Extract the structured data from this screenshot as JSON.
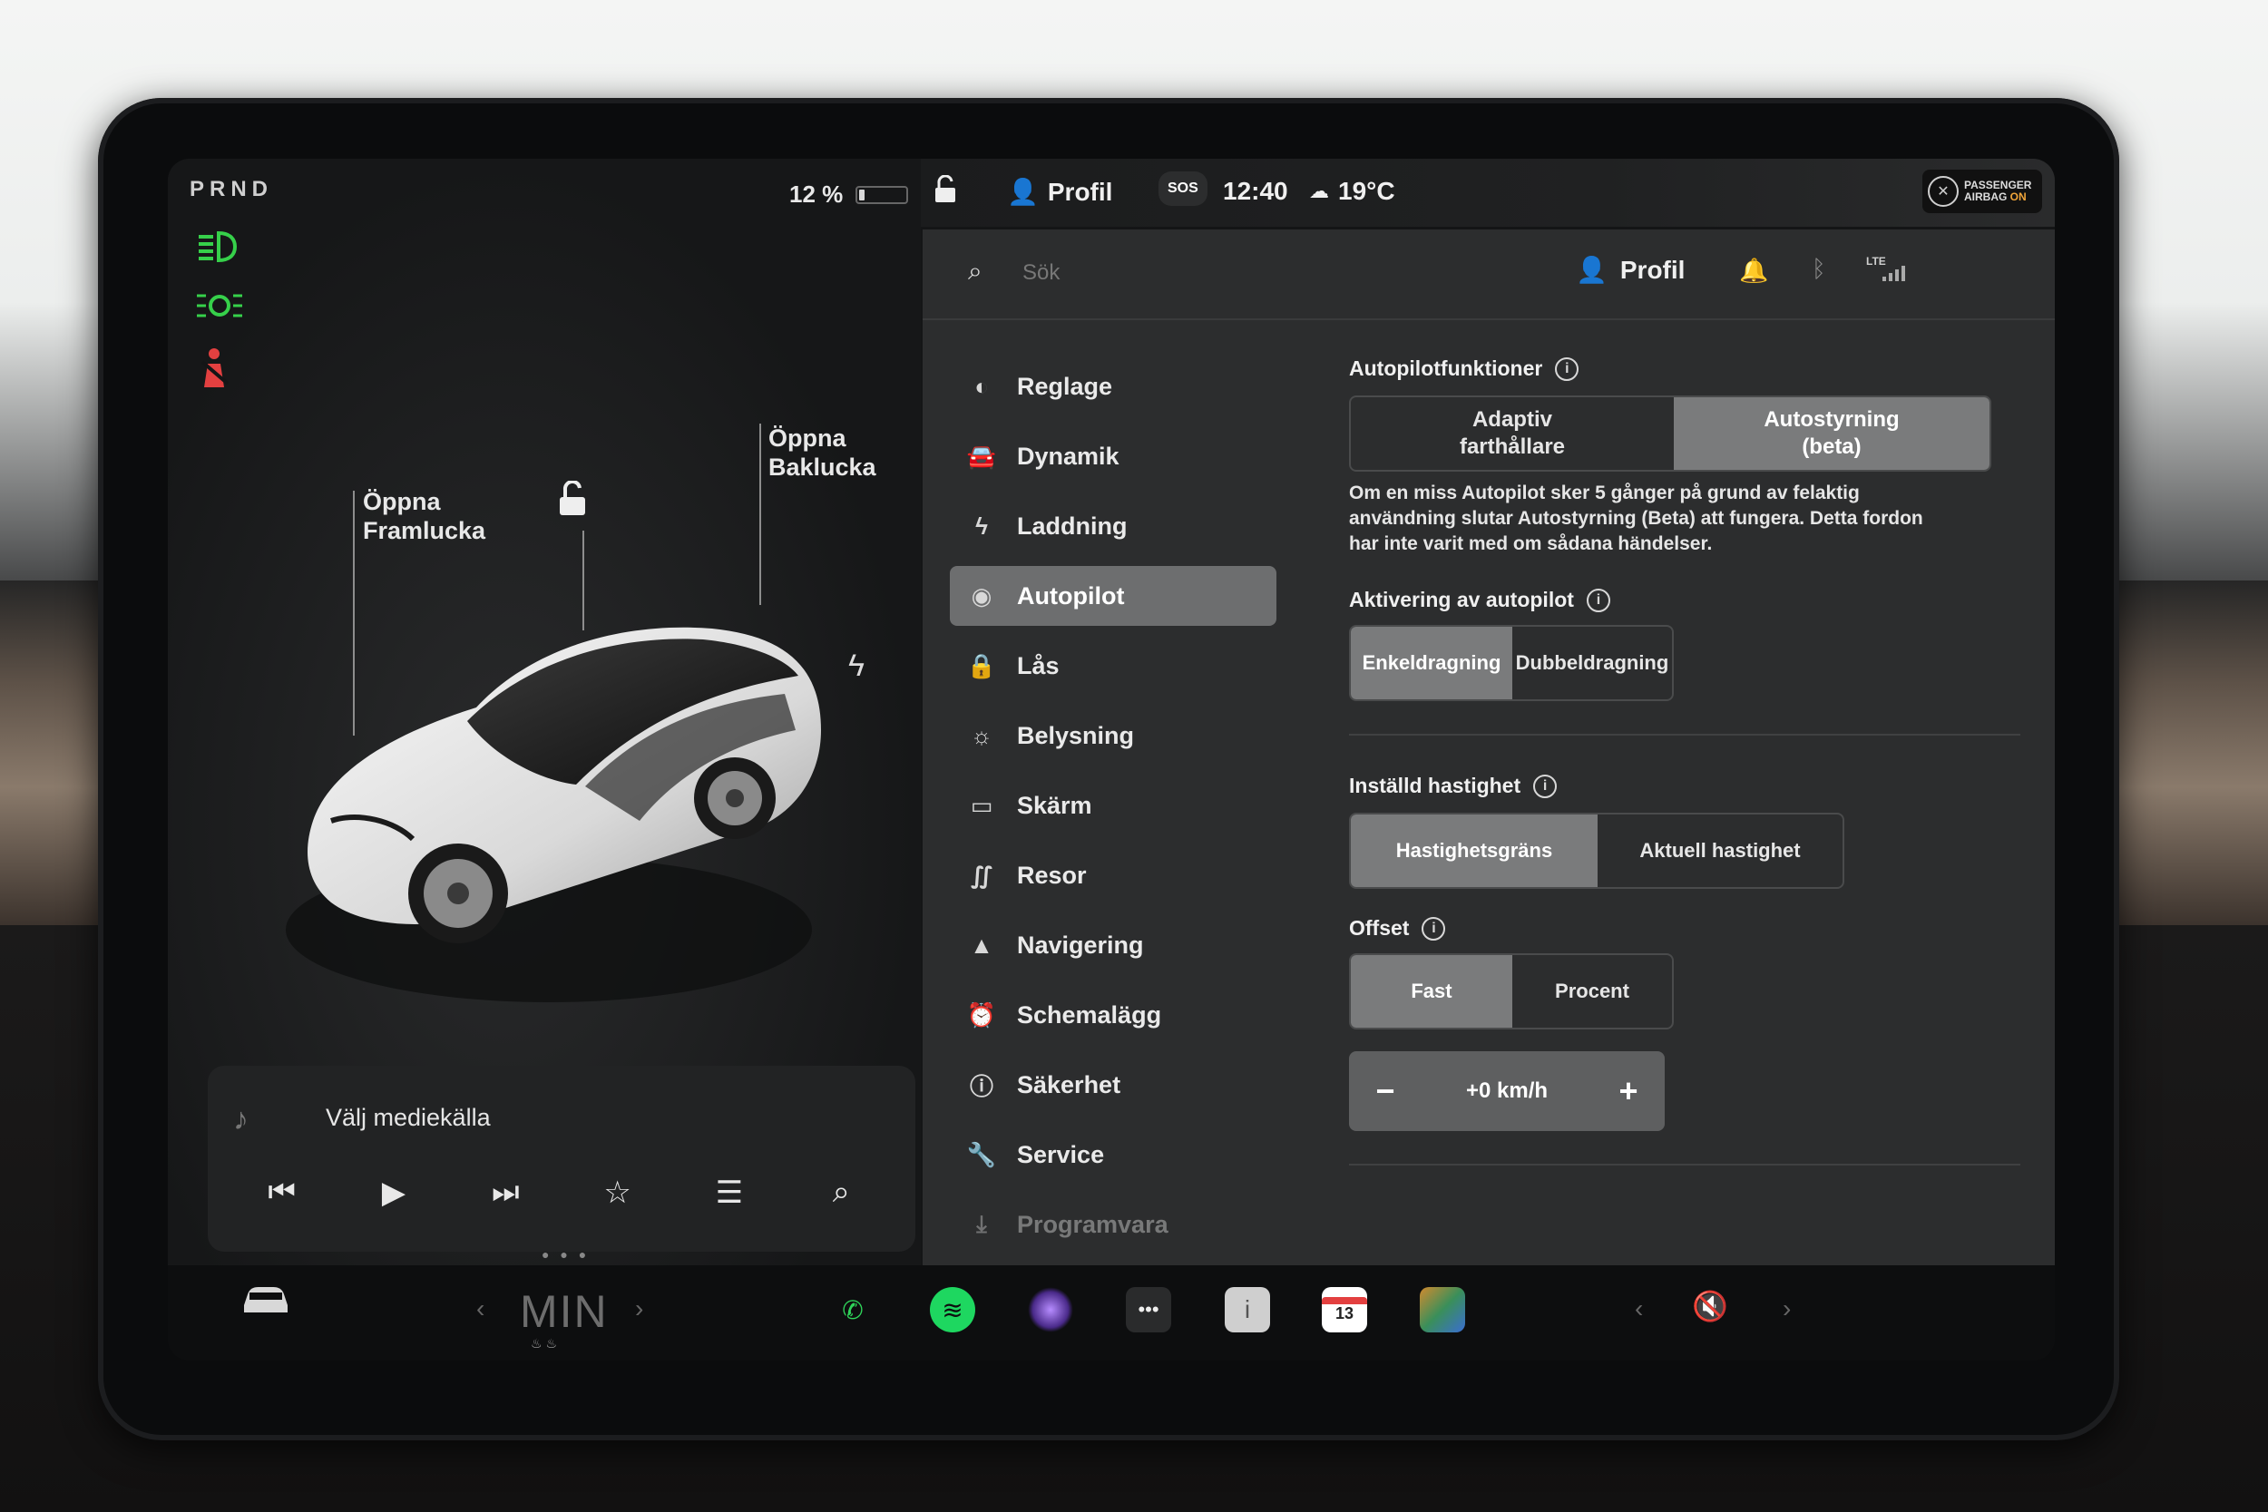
{
  "drive": {
    "gears": "PRND"
  },
  "battery": {
    "percent_label": "12 %",
    "level": 0.12
  },
  "left_pane": {
    "frunk_label_1": "Öppna",
    "frunk_label_2": "Framlucka",
    "trunk_label_1": "Öppna",
    "trunk_label_2": "Baklucka"
  },
  "media": {
    "source_label": "Välj mediekälla"
  },
  "statusbar": {
    "profile": "Profil",
    "sos": "SOS",
    "time": "12:40",
    "temperature": "19°C",
    "airbag_line1": "PASSENGER",
    "airbag_line2_a": "AIRBAG ",
    "airbag_line2_b": "ON"
  },
  "settings": {
    "search_placeholder": "Sök",
    "profile": "Profil",
    "network": "LTE",
    "menu": [
      {
        "label": "Reglage",
        "icon": "toggle-icon"
      },
      {
        "label": "Dynamik",
        "icon": "car-icon"
      },
      {
        "label": "Laddning",
        "icon": "bolt-icon"
      },
      {
        "label": "Autopilot",
        "icon": "steering-wheel-icon",
        "active": true
      },
      {
        "label": "Lås",
        "icon": "lock-icon"
      },
      {
        "label": "Belysning",
        "icon": "sun-icon"
      },
      {
        "label": "Skärm",
        "icon": "display-icon"
      },
      {
        "label": "Resor",
        "icon": "trips-icon"
      },
      {
        "label": "Navigering",
        "icon": "navigation-icon"
      },
      {
        "label": "Schemalägg",
        "icon": "schedule-icon"
      },
      {
        "label": "Säkerhet",
        "icon": "safety-icon"
      },
      {
        "label": "Service",
        "icon": "wrench-icon"
      },
      {
        "label": "Programvara",
        "icon": "download-icon"
      }
    ],
    "autopilot_features": {
      "title": "Autopilotfunktioner",
      "option_1_line1": "Adaptiv",
      "option_1_line2": "farthållare",
      "option_2_line1": "Autostyrning",
      "option_2_line2": "(beta)",
      "selected": "Autostyrning (beta)",
      "description_1": "Om en miss Autopilot sker 5 gånger på grund av felaktig",
      "description_2": "användning slutar Autostyrning (Beta) att fungera. Detta fordon",
      "description_3": "har inte varit med om sådana händelser."
    },
    "activation": {
      "title": "Aktivering av autopilot",
      "option_1": "Enkeldragning",
      "option_2": "Dubbeldragning",
      "selected": "Enkeldragning"
    },
    "set_speed": {
      "title": "Inställd hastighet",
      "option_1": "Hastighetsgräns",
      "option_2": "Aktuell hastighet",
      "selected": "Hastighetsgräns"
    },
    "offset": {
      "title": "Offset",
      "option_1": "Fast",
      "option_2": "Procent",
      "selected": "Fast",
      "value": "+0 km/h"
    }
  },
  "dock": {
    "climate_label": "MIN",
    "calendar_day": "13"
  },
  "colors": {
    "indicator_green": "#36d04a",
    "indicator_red": "#e34040",
    "active_menu": "#6d6e6f",
    "spotify_green": "#1ed760",
    "phone_green": "#2fd45a",
    "airbag_on": "#f0a53a"
  }
}
